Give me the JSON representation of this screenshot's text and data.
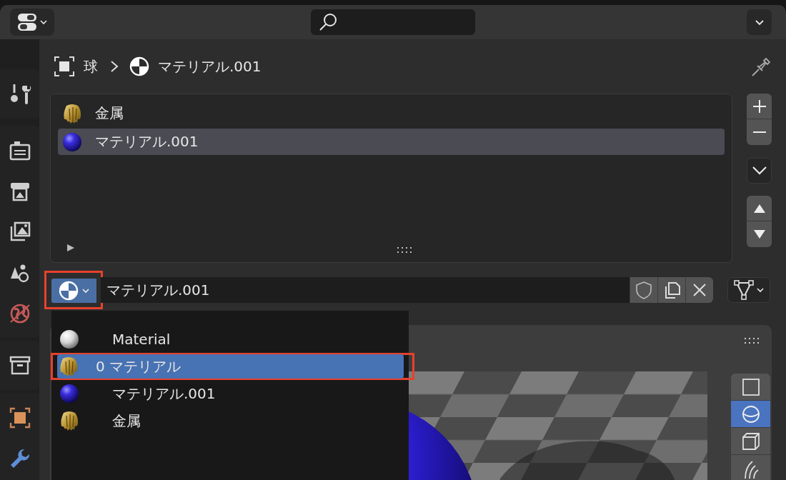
{
  "breadcrumb": {
    "object": "球",
    "material": "マテリアル.001"
  },
  "material_slots": {
    "items": [
      {
        "name": "金属",
        "kind": "gold",
        "selected": false
      },
      {
        "name": "マテリアル.001",
        "kind": "blue",
        "selected": true
      }
    ]
  },
  "material_selector": {
    "browse_annotated": true,
    "name": "マテリアル.001"
  },
  "browse_menu": {
    "items": [
      {
        "name": "Material",
        "kind": "white",
        "selected": false,
        "annotated": false
      },
      {
        "name": "0 マテリアル",
        "kind": "gold",
        "selected": true,
        "annotated": true
      },
      {
        "name": "マテリアル.001",
        "kind": "blue",
        "selected": false,
        "annotated": false
      },
      {
        "name": "金属",
        "kind": "gold",
        "selected": false,
        "annotated": false
      }
    ]
  },
  "preview": {
    "types": [
      {
        "kind": "flat",
        "selected": false
      },
      {
        "kind": "sphere",
        "selected": true
      },
      {
        "kind": "cube",
        "selected": false
      },
      {
        "kind": "hair",
        "selected": false
      }
    ]
  }
}
